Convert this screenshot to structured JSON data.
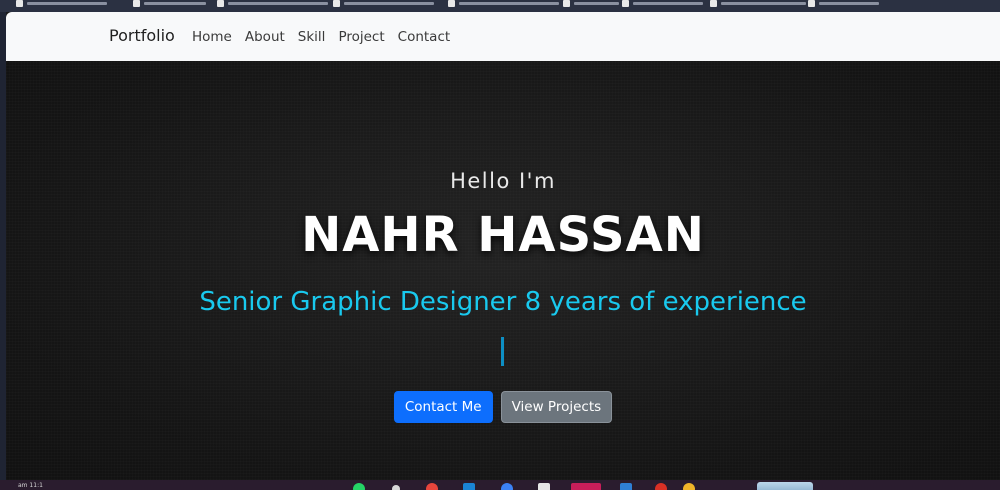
{
  "navbar": {
    "brand": "Portfolio",
    "links": [
      "Home",
      "About",
      "Skill",
      "Project",
      "Contact"
    ]
  },
  "hero": {
    "greeting": "Hello I'm",
    "name": "NAHR HASSAN",
    "subtitle": "Senior Graphic Designer 8 years of experience",
    "buttons": {
      "contact": "Contact Me",
      "projects": "View Projects"
    }
  },
  "taskbar": {
    "clock": "am 11:1"
  },
  "icons": {
    "taskbar": [
      "whatsapp-icon",
      "chrome-icon",
      "files-icon",
      "edge-icon",
      "photoshop-icon",
      "vscode-icon",
      "chrome-profile-icon",
      "opera-icon"
    ]
  },
  "colors": {
    "accent_cyan": "#19c9ee",
    "primary": "#0d6efd",
    "secondary": "#6c757d",
    "navbar_bg": "#f8f9fa",
    "hero_bg": "#1a1a1a"
  }
}
